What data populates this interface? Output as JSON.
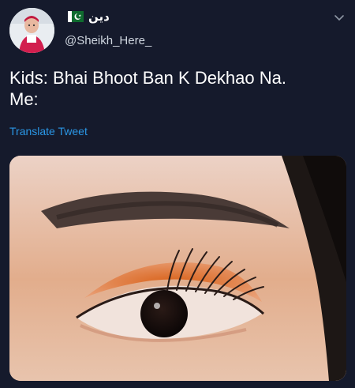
{
  "tweet": {
    "display_name": "دین",
    "handle": "@Sheikh_Here_",
    "text": "Kids: Bhai Bhoot Ban K Dekhao Na.\nMe:",
    "translate_label": "Translate Tweet"
  },
  "icons": {
    "avatar": "avatar-photo",
    "flag": "pakistan-flag-icon",
    "menu": "chevron-down-icon"
  },
  "colors": {
    "background": "#151a2c",
    "link": "#2a97e6",
    "handle": "#cfd6df"
  }
}
